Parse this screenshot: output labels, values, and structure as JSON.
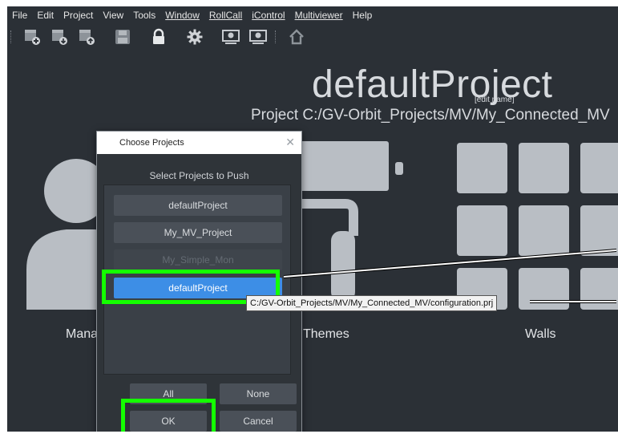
{
  "menubar": {
    "items": [
      "File",
      "Edit",
      "Project",
      "View",
      "Tools",
      "Window",
      "RollCall",
      "iControl",
      "Multiviewer",
      "Help"
    ]
  },
  "toolbar": {
    "icons": [
      "new-project-icon",
      "import-project-icon",
      "export-project-icon",
      "save-icon",
      "lock-icon",
      "settings-icon",
      "push-icon",
      "pull-icon",
      "home-icon"
    ]
  },
  "project": {
    "title": "defaultProject",
    "edit_link": "[edit name]",
    "path": "Project C:/GV-Orbit_Projects/MV/My_Connected_MV"
  },
  "tiles": {
    "manage_label": "Mana",
    "themes_label": "Themes",
    "walls_label": "Walls"
  },
  "dialog": {
    "title": "Choose Projects",
    "close_glyph": "✕",
    "subtitle": "Select Projects to Push",
    "projects": [
      {
        "label": "defaultProject",
        "state": "normal"
      },
      {
        "label": "My_MV_Project",
        "state": "normal"
      },
      {
        "label": "My_Simple_Mon",
        "state": "disabled"
      },
      {
        "label": "defaultProject",
        "state": "selected"
      }
    ],
    "all_label": "All",
    "none_label": "None",
    "ok_label": "OK",
    "cancel_label": "Cancel"
  },
  "tooltip": {
    "text": "C:/GV-Orbit_Projects/MV/My_Connected_MV/configuration.prj"
  },
  "colors": {
    "background": "#2b3036",
    "tile": "#b9bec4",
    "selection": "#3d8ee6",
    "highlight": "#14ff00"
  }
}
